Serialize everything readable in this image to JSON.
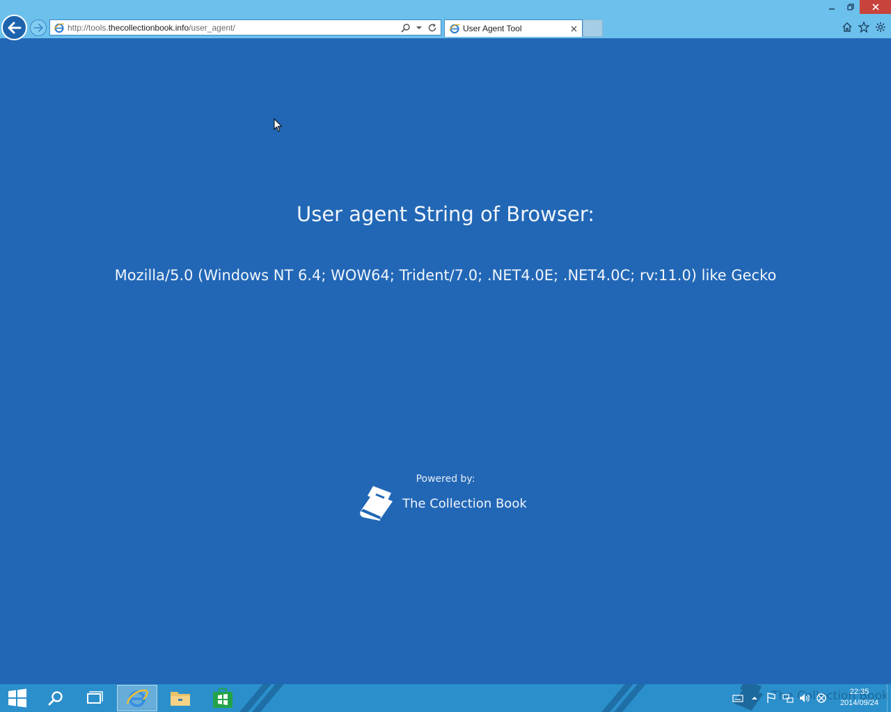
{
  "browser": {
    "address_bar": {
      "url_prefix": "http://tools.",
      "url_domain": "thecollectionbook.info",
      "url_path": "/user_agent/"
    },
    "tab": {
      "title": "User Agent Tool"
    },
    "icons": {
      "back": "back-arrow-icon",
      "forward": "forward-arrow-icon",
      "search": "search-icon",
      "refresh": "refresh-icon",
      "home": "home-icon",
      "favorites": "star-icon",
      "tools": "gear-icon"
    }
  },
  "page": {
    "heading": "User agent String of Browser:",
    "user_agent": "Mozilla/5.0 (Windows NT 6.4; WOW64; Trident/7.0; .NET4.0E; .NET4.0C; rv:11.0) like Gecko",
    "powered_by": "Powered by:",
    "brand_name": "The Collection Book"
  },
  "taskbar": {
    "watermark": "The Collection Book",
    "clock_time": "22:35",
    "clock_date": "2014/09/24"
  },
  "colors": {
    "page_background": "#2267b6",
    "chrome_background": "#6cc0ec",
    "taskbar_background": "#2b8fcb",
    "close_button": "#c7433c"
  }
}
